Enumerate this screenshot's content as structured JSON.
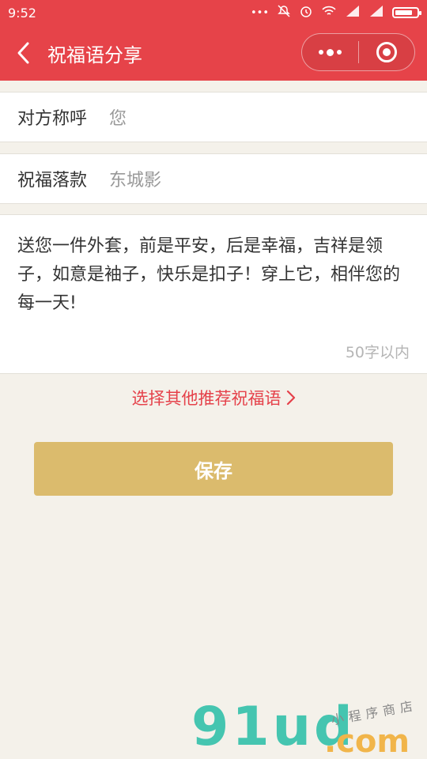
{
  "status_bar": {
    "time": "9:52",
    "signal_dots": "•••"
  },
  "nav": {
    "title": "祝福语分享"
  },
  "form": {
    "recipient_label": "对方称呼",
    "recipient_value": "您",
    "signature_label": "祝福落款",
    "signature_value": "东城影"
  },
  "blessing": {
    "text": "送您一件外套，前是平安，后是幸福，吉祥是领子，如意是袖子，快乐是扣子！穿上它，相伴您的每一天!",
    "limit_hint": "50字以内"
  },
  "recommend_link": "选择其他推荐祝福语",
  "save_label": "保存",
  "watermark": {
    "main": "91ud",
    "domain": ".com",
    "tagline": "小程序商店"
  },
  "colors": {
    "header": "#e64349",
    "accent": "#e5414a",
    "button": "#dbbb6d",
    "background": "#f4f1ea"
  }
}
